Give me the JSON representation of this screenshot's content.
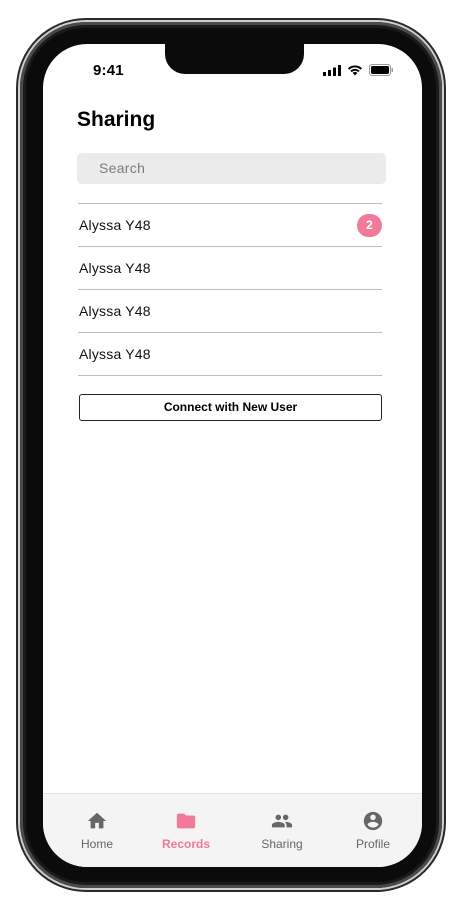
{
  "status_bar": {
    "time": "9:41"
  },
  "header": {
    "title": "Sharing"
  },
  "search": {
    "placeholder": "Search"
  },
  "users": [
    {
      "name": "Alyssa Y48",
      "badge": "2"
    },
    {
      "name": "Alyssa Y48",
      "badge": ""
    },
    {
      "name": "Alyssa Y48",
      "badge": ""
    },
    {
      "name": "Alyssa Y48",
      "badge": ""
    }
  ],
  "connect_button": {
    "label": "Connect with New User"
  },
  "tab_bar": {
    "tabs": [
      {
        "label": "Home",
        "icon": "home-icon",
        "active": false
      },
      {
        "label": "Records",
        "icon": "folder-icon",
        "active": true
      },
      {
        "label": "Sharing",
        "icon": "people-icon",
        "active": false
      },
      {
        "label": "Profile",
        "icon": "account-circle-icon",
        "active": false
      }
    ]
  },
  "colors": {
    "accent": "#f07a97",
    "search_bg": "#ebebeb",
    "tab_bar_bg": "#f4f4f4",
    "divider": "#bdbdbd"
  }
}
